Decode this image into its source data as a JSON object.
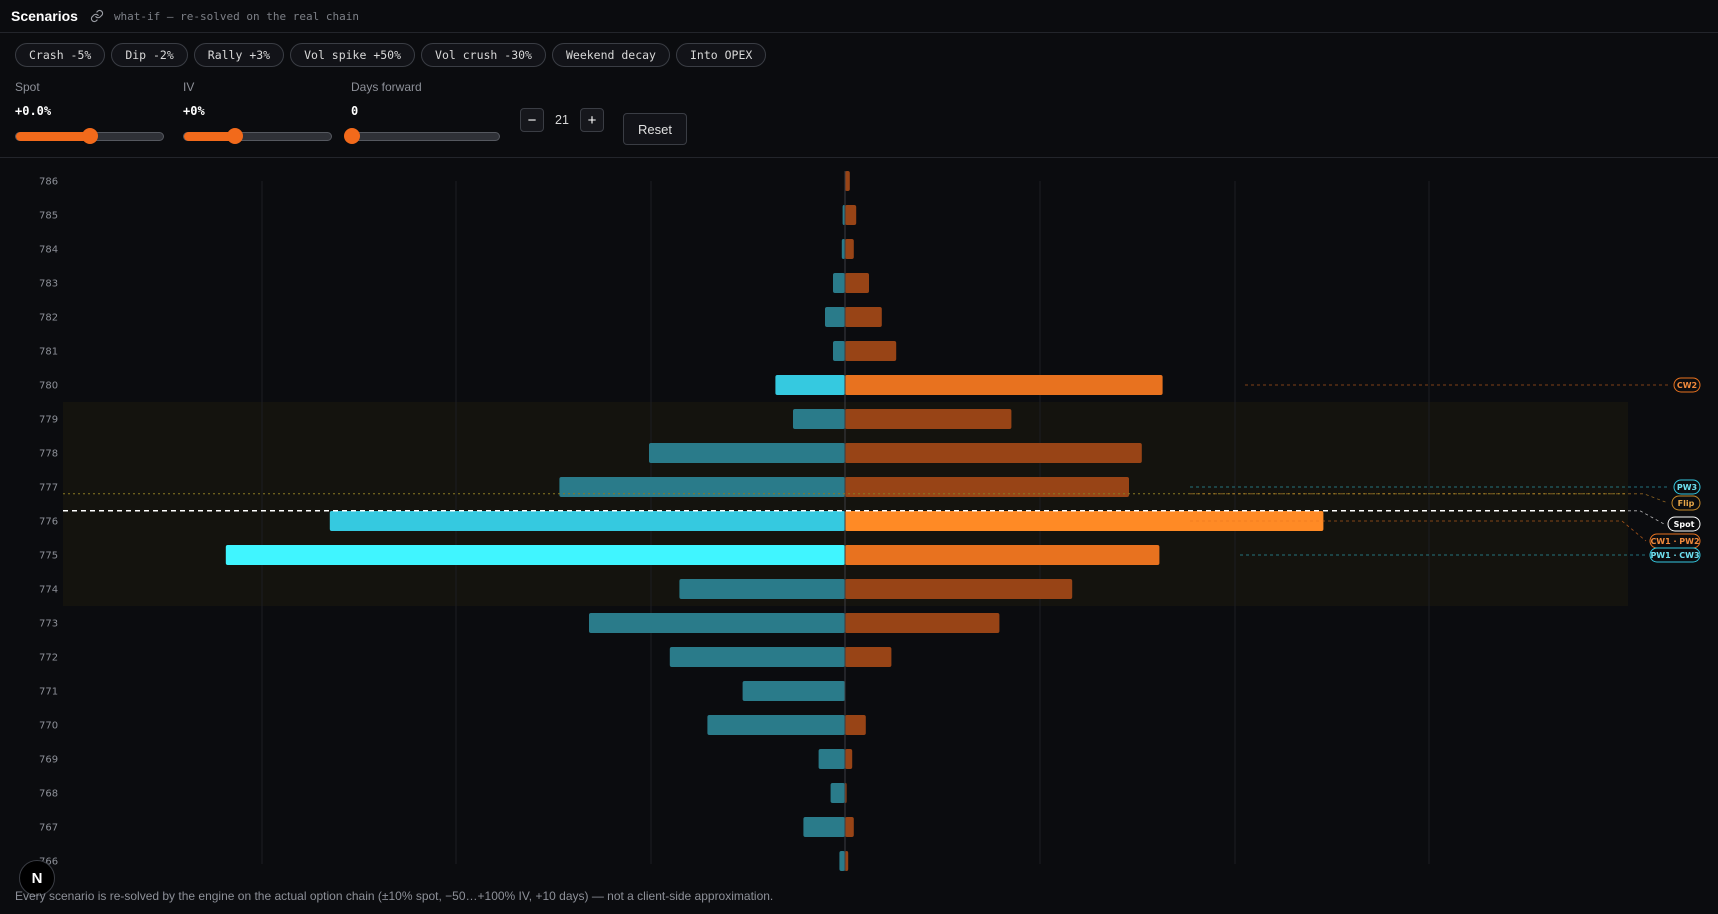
{
  "header": {
    "title": "Scenarios",
    "subtitle": "what-if — re-solved on the real chain"
  },
  "presets": [
    "Crash -5%",
    "Dip -2%",
    "Rally +3%",
    "Vol spike +50%",
    "Vol crush -30%",
    "Weekend decay",
    "Into OPEX"
  ],
  "controls": {
    "spot": {
      "label": "Spot",
      "value": "+0.0%",
      "level": 0.5
    },
    "iv": {
      "label": "IV",
      "value": "+0%",
      "level": 0.35
    },
    "days": {
      "label": "Days forward",
      "value": "0",
      "level": 0.0
    },
    "stepper": {
      "minus": "−",
      "value": "21",
      "plus": "+"
    },
    "reset_label": "Reset"
  },
  "chart_data": {
    "type": "bar",
    "orientation": "horizontal-diverging",
    "strikes": [
      786,
      785,
      784,
      783,
      782,
      781,
      780,
      779,
      778,
      777,
      776,
      775,
      774,
      773,
      772,
      771,
      770,
      769,
      768,
      767,
      766
    ],
    "put_values": [
      0,
      3,
      4,
      15,
      25,
      15,
      87,
      65,
      245,
      357,
      644,
      774,
      207,
      320,
      219,
      128,
      172,
      33,
      18,
      52,
      7
    ],
    "call_values": [
      6,
      14,
      11,
      30,
      46,
      64,
      397,
      208,
      371,
      355,
      598,
      393,
      284,
      193,
      58,
      0,
      26,
      9,
      2,
      11,
      4
    ],
    "highlight_strikes": [
      780,
      776,
      775
    ],
    "band": [
      774,
      779
    ],
    "spot": 776.3,
    "flip": 776.8,
    "markers": [
      {
        "label": "CW2",
        "strike": 780
      },
      {
        "label": "PW3",
        "strike": 777
      },
      {
        "label": "Flip",
        "strike": 776.8
      },
      {
        "label": "Spot",
        "strike": 776.3
      },
      {
        "label": "CW1 · PW2",
        "strike": 776
      },
      {
        "label": "PW1 · CW3",
        "strike": 775
      }
    ],
    "colors": {
      "put": "#2a7b8a",
      "put_highlight": "#35c9e0",
      "put_max": "#40f5ff",
      "call": "#984416",
      "call_highlight": "#e8721f",
      "call_max": "#ff8a25",
      "band": "#14130e"
    }
  },
  "footer": "Every scenario is re-solved by the engine on the actual option chain (±10% spot, −50…+100% IV, +10 days) — not a client-side approximation.",
  "badge": "N"
}
